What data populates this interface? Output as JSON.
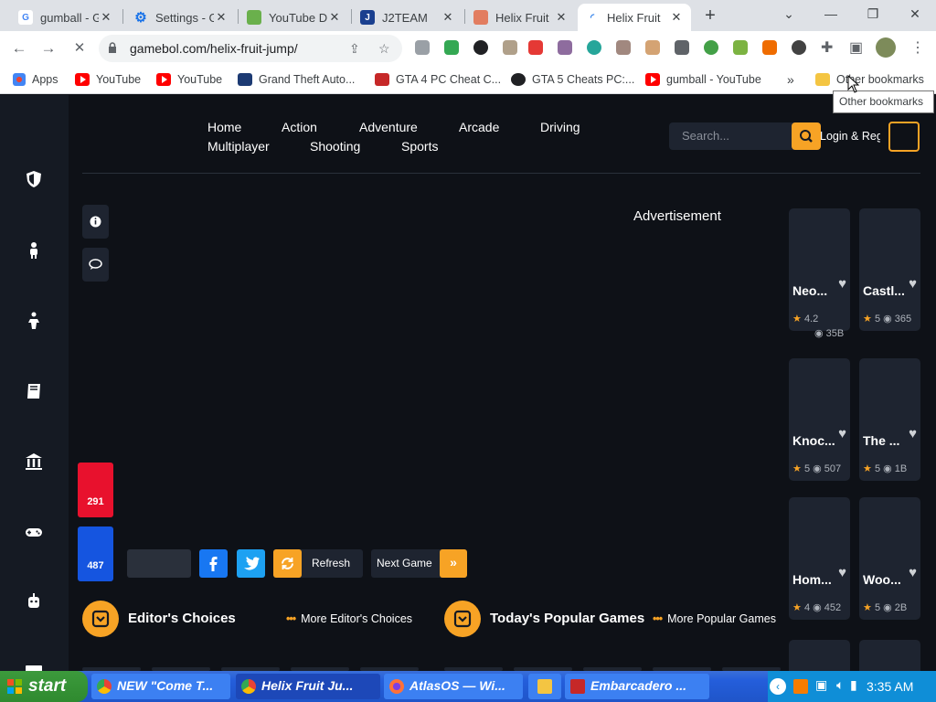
{
  "browser": {
    "tabs": [
      {
        "title": "gumball - G",
        "icon": "google-icon"
      },
      {
        "title": "Settings - G",
        "icon": "gear-icon"
      },
      {
        "title": "YouTube D",
        "icon": "extension-icon"
      },
      {
        "title": "J2TEAM",
        "icon": "j2team-icon"
      },
      {
        "title": "Helix Fruit",
        "icon": "game-icon"
      },
      {
        "title": "Helix Fruit",
        "icon": "loading-icon"
      }
    ],
    "url": "gamebol.com/helix-fruit-jump/",
    "bookmarks": [
      "Apps",
      "YouTube",
      "YouTube",
      "Grand Theft Auto...",
      "GTA 4 PC Cheat C...",
      "GTA 5 Cheats PC:...",
      "gumball - YouTube",
      "Other bookmarks"
    ],
    "tooltip": "Other bookmarks",
    "chevron": "»"
  },
  "site": {
    "nav": [
      "Home",
      "Action",
      "Adventure",
      "Arcade",
      "Driving",
      "Multiplayer",
      "Shooting",
      "Sports"
    ],
    "search_placeholder": "Search...",
    "login": "Login & Regi",
    "advertisement": "Advertisement",
    "likes": "291",
    "dislikes": "487",
    "refresh": "Refresh",
    "next_game": "Next Game",
    "next_arrow": "»",
    "editors_choices": "Editor's Choices",
    "more_editors": "More Editor's Choices",
    "popular_games": "Today's Popular Games",
    "more_popular": "More Popular Games",
    "dots": "•••",
    "cards": [
      {
        "name": "Neo...",
        "rating": "4.2",
        "views": "35B"
      },
      {
        "name": "Castl...",
        "rating": "5",
        "views": "365"
      },
      {
        "name": "Knoc...",
        "rating": "5",
        "views": "507"
      },
      {
        "name": "The ...",
        "rating": "5",
        "views": "1B"
      },
      {
        "name": "Hom...",
        "rating": "4",
        "views": "452"
      },
      {
        "name": "Woo...",
        "rating": "5",
        "views": "2B"
      }
    ]
  },
  "taskbar": {
    "start": "start",
    "tasks": [
      "NEW \"Come T...",
      "Helix Fruit Ju...",
      "AtlasOS — Wi...",
      "Embarcadero ..."
    ],
    "time": "3:35 AM"
  },
  "colors": {
    "accent": "#f7a325",
    "like": "#e8112d",
    "dislike": "#1555e0",
    "facebook": "#1877f2",
    "twitter": "#1da1f2"
  }
}
